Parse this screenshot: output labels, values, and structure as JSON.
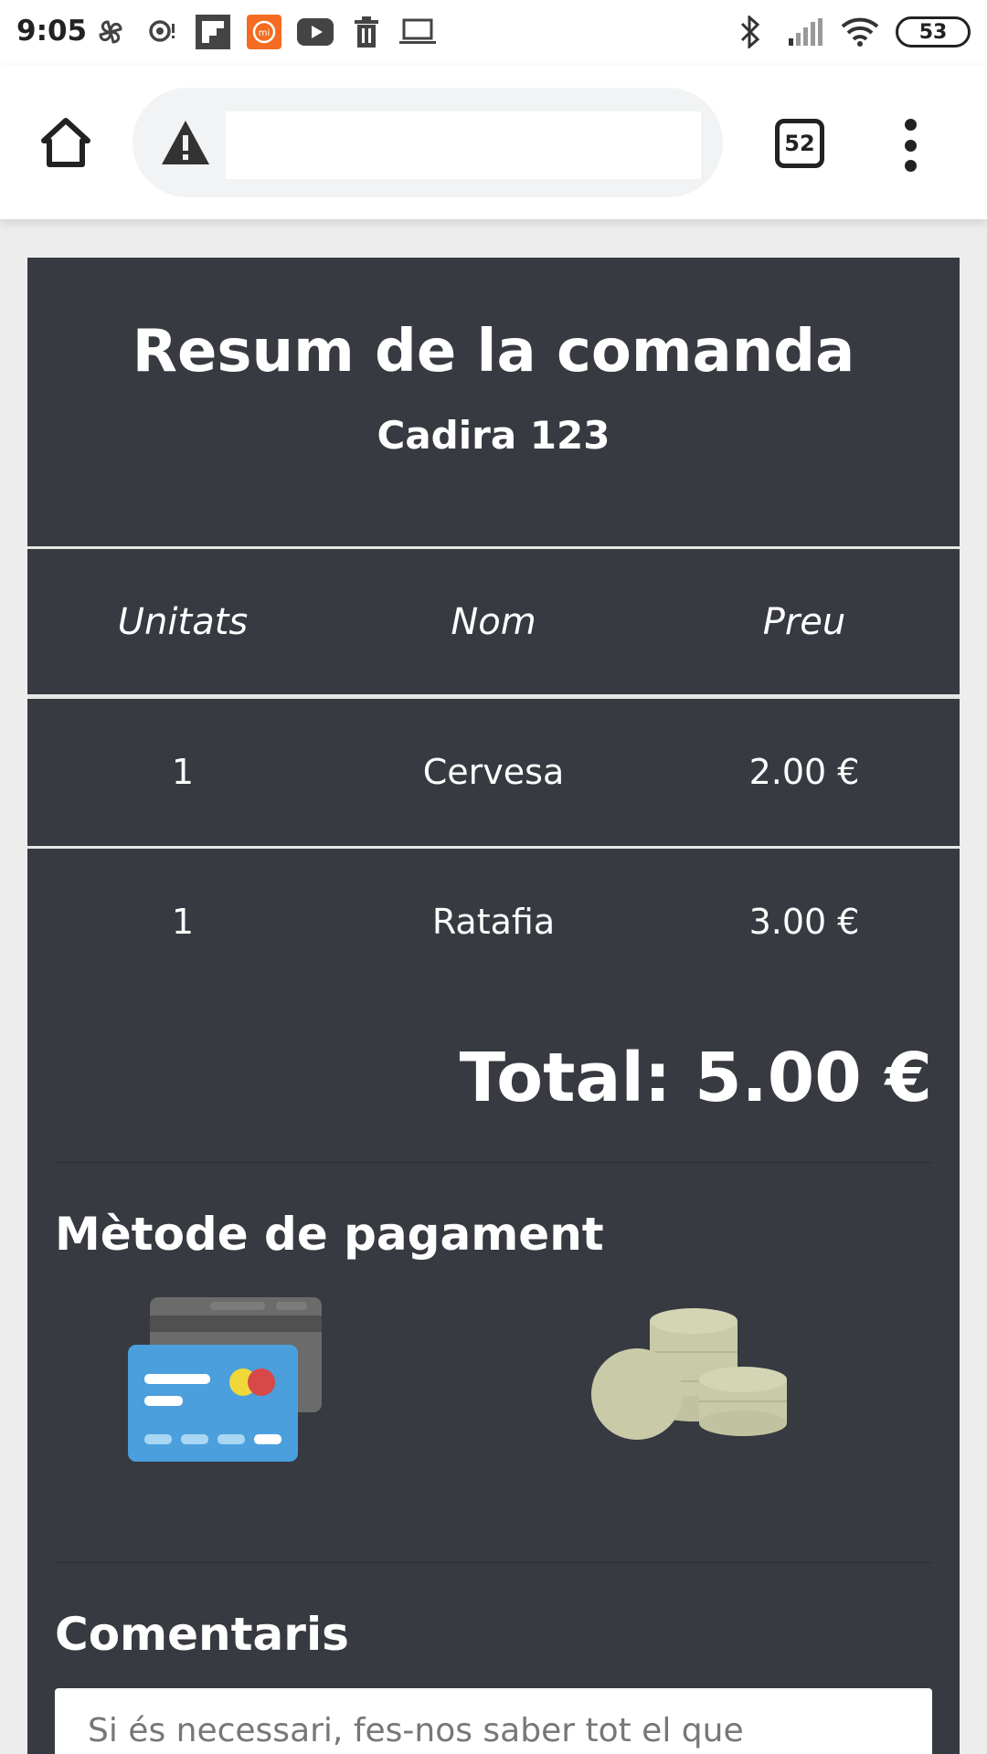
{
  "status_bar": {
    "time": "9:05",
    "battery": "53",
    "left_icons": [
      "pinwheel-icon",
      "chat-icon",
      "flipboard-icon",
      "mi-icon",
      "youtube-icon",
      "trash-icon",
      "laptop-icon"
    ],
    "right_icons": [
      "bluetooth-icon",
      "signal-icon",
      "wifi-icon",
      "battery-icon"
    ]
  },
  "browser": {
    "url": "",
    "tab_count": "52",
    "home_icon": "home-icon",
    "security_icon": "warning-icon",
    "menu_icon": "more-vert-icon"
  },
  "order": {
    "title": "Resum de la comanda",
    "subtitle": "Cadira 123",
    "columns": [
      "Unitats",
      "Nom",
      "Preu"
    ],
    "items": [
      {
        "units": "1",
        "name": "Cervesa",
        "price": "2.00 €"
      },
      {
        "units": "1",
        "name": "Ratafia",
        "price": "3.00 €"
      }
    ],
    "total": "Total: 5.00 €"
  },
  "payment": {
    "title": "Mètode de pagament",
    "options": [
      "credit-card-icon",
      "coins-icon"
    ]
  },
  "comments": {
    "title": "Comentaris",
    "placeholder": "Si és necessari, fes-nos saber tot el que"
  },
  "colors": {
    "card_background": "#373a41",
    "card_blue": "#4a9fdc",
    "coins": "#c9cba8"
  }
}
